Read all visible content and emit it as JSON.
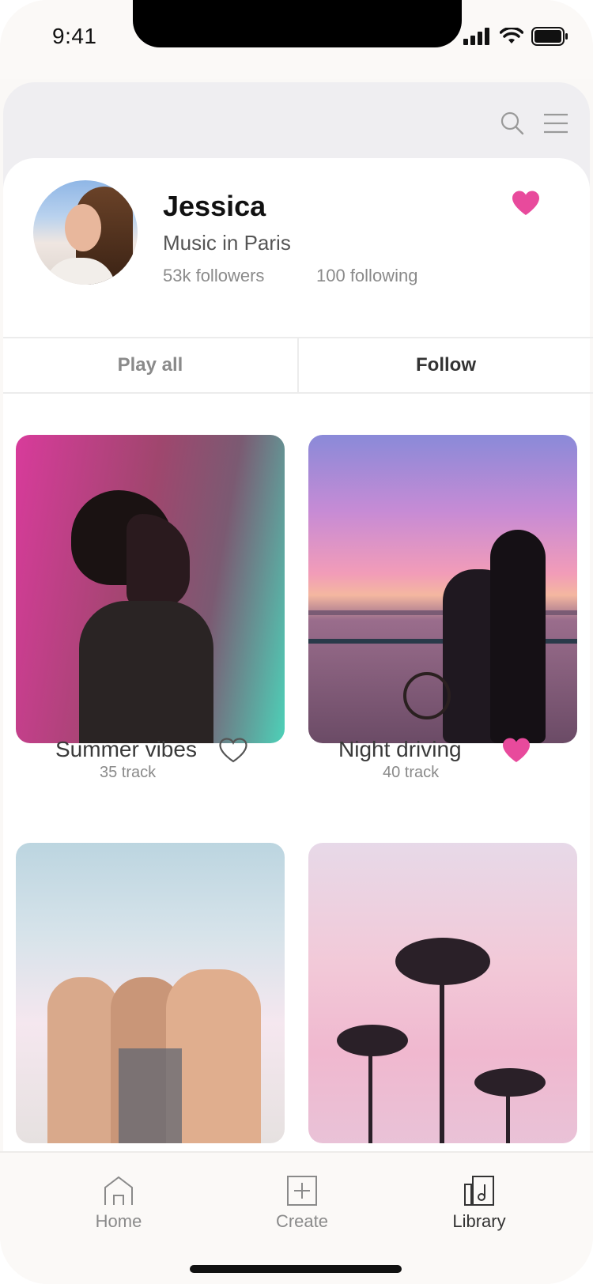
{
  "status_bar": {
    "time": "9:41"
  },
  "profile": {
    "name": "Jessica",
    "subtitle": "Music in Paris",
    "followers": "53k followers",
    "following": "100 following",
    "liked": true
  },
  "actions": {
    "play_all": "Play all",
    "follow": "Follow"
  },
  "playlists": [
    {
      "title": "Summer vibes",
      "tracks": "35 track",
      "liked": false
    },
    {
      "title": "Night driving",
      "tracks": "40 track",
      "liked": true
    }
  ],
  "tabs": [
    {
      "label": "Home",
      "icon": "home-icon",
      "active": false
    },
    {
      "label": "Create",
      "icon": "plus-square-icon",
      "active": false
    },
    {
      "label": "Library",
      "icon": "library-icon",
      "active": true
    }
  ],
  "colors": {
    "accent": "#e84a9c",
    "text": "#111111",
    "muted": "#8a8a8a"
  }
}
